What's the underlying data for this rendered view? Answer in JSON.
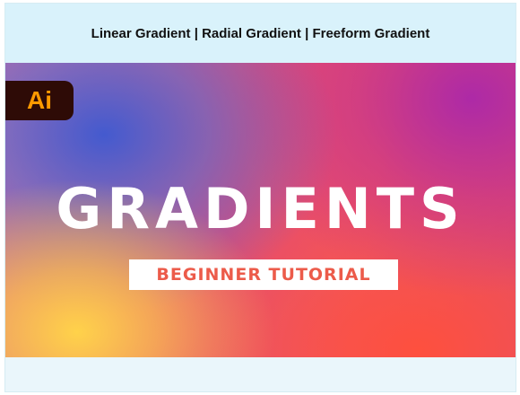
{
  "header": {
    "title": "Linear Gradient | Radial Gradient | Freeform Gradient"
  },
  "thumbnail": {
    "logo_text": "Ai",
    "headline": "GRADIENTS",
    "subtitle": "BEGINNER TUTORIAL",
    "colors": {
      "logo_bg": "#2e0b06",
      "logo_fg": "#ff9a00",
      "subtitle_fg": "#ec5b4a",
      "gradient_top_left": "#3c5ad2",
      "gradient_top_right": "#aa28aa",
      "gradient_bottom_left": "#ffd24a",
      "gradient_bottom_right": "#ff503c"
    }
  }
}
